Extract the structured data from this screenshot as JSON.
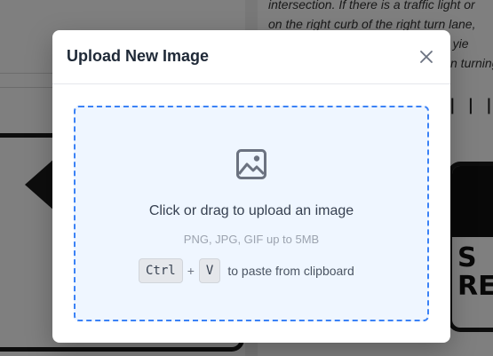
{
  "background": {
    "text_lines": [
      "intersection. If there is a traffic light or",
      "on the right curb of the right turn lane,",
      "ays yie",
      "n turning"
    ],
    "sign_letters": [
      "S",
      "RE"
    ]
  },
  "modal": {
    "title": "Upload New Image",
    "close_icon": "close-icon",
    "dropzone": {
      "icon": "image-icon",
      "main_text": "Click or drag to upload an image",
      "sub_text": "PNG, JPG, GIF up to 5MB",
      "paste": {
        "key1": "Ctrl",
        "plus": "+",
        "key2": "V",
        "text": "to paste from clipboard"
      }
    }
  },
  "colors": {
    "accent": "#3b82f6",
    "dropzone_bg": "#eff6ff",
    "overlay": "rgba(0,0,0,0.5)"
  }
}
